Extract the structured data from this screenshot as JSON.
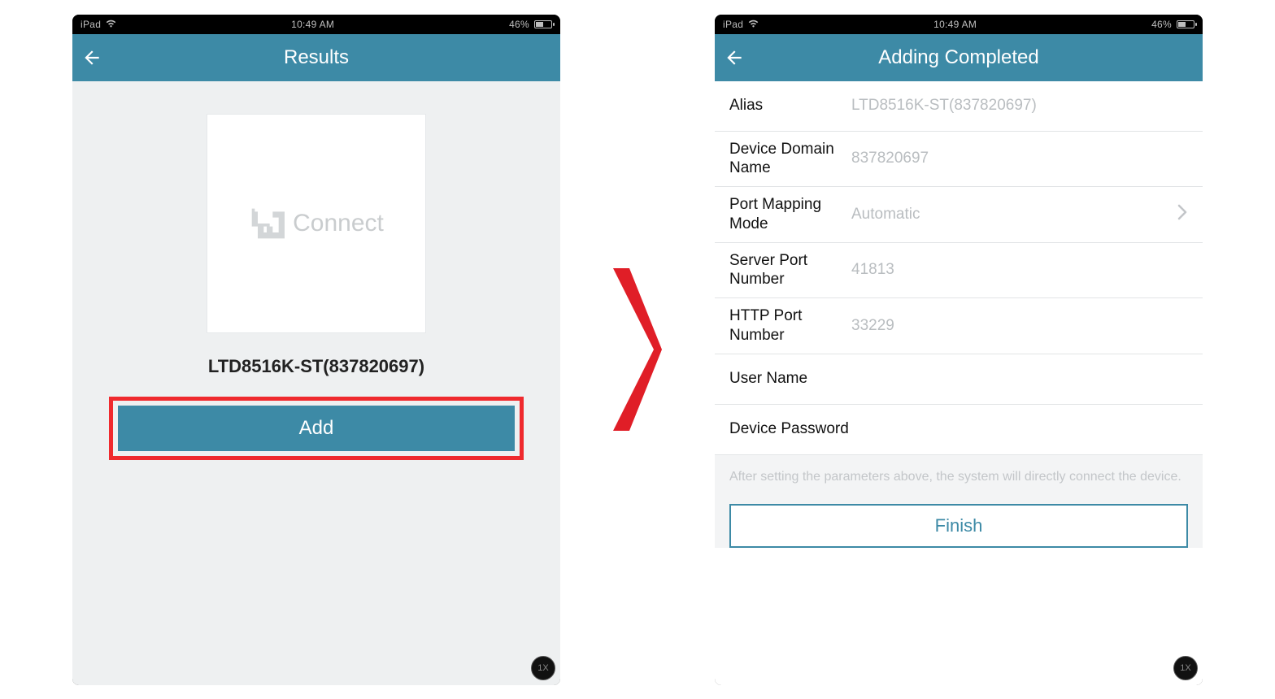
{
  "statusbar": {
    "device_label": "iPad",
    "time": "10:49 AM",
    "battery_pct": "46%"
  },
  "left_screen": {
    "title": "Results",
    "thumb_label": "Connect",
    "device_name": "LTD8516K-ST(837820697)",
    "add_button": "Add"
  },
  "right_screen": {
    "title": "Adding Completed",
    "fields": {
      "alias_label": "Alias",
      "alias_value": "LTD8516K-ST(837820697)",
      "domain_label": "Device Domain Name",
      "domain_value": "837820697",
      "portmap_label": "Port Mapping Mode",
      "portmap_value": "Automatic",
      "server_port_label": "Server Port Number",
      "server_port_value": "41813",
      "http_port_label": "HTTP Port Number",
      "http_port_value": "33229",
      "username_label": "User Name",
      "username_value": "",
      "password_label": "Device Password",
      "password_value": ""
    },
    "footnote": "After setting the parameters above, the system will directly connect the device.",
    "finish_button": "Finish"
  },
  "badge_1x": "1X"
}
